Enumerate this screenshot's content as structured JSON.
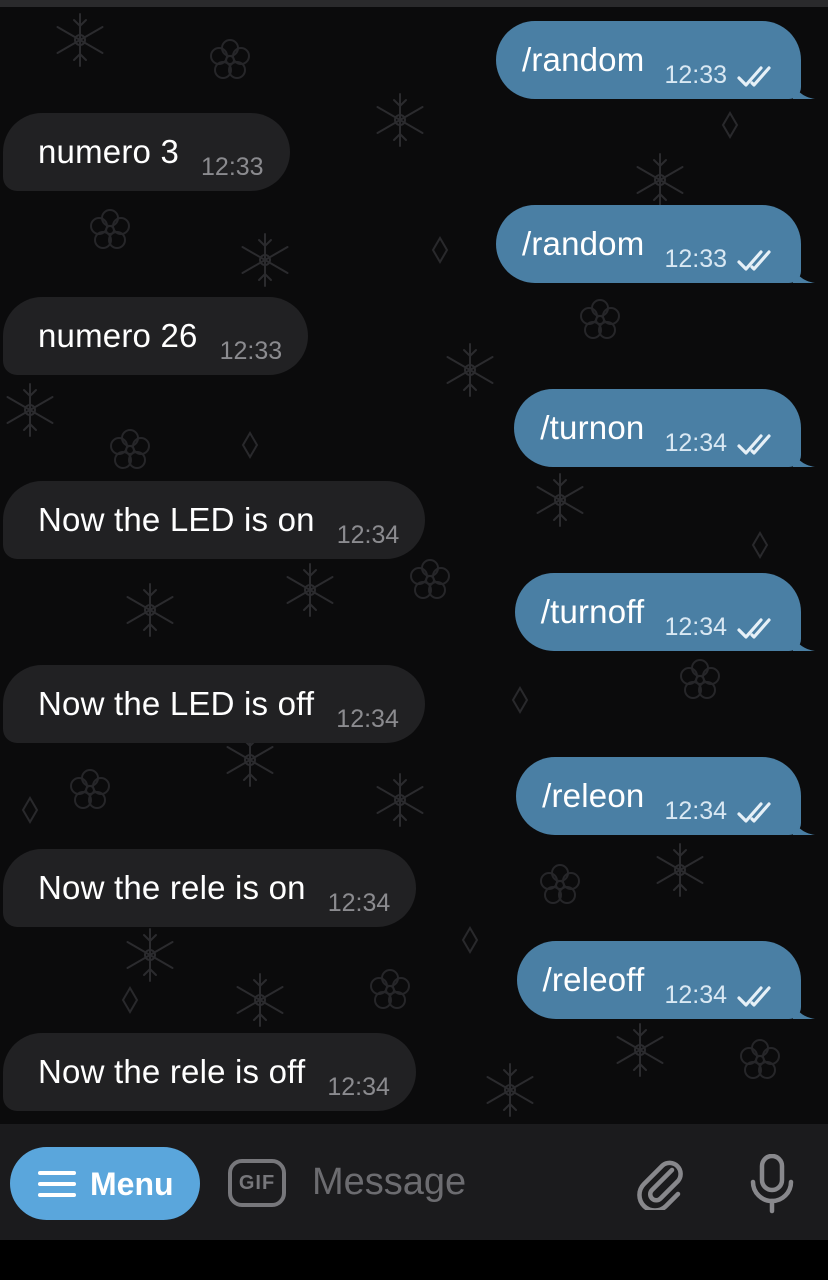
{
  "messages": [
    {
      "direction": "out",
      "text": "/random",
      "time": "12:33",
      "status": "read"
    },
    {
      "direction": "in",
      "text": "numero 3",
      "time": "12:33"
    },
    {
      "direction": "out",
      "text": "/random",
      "time": "12:33",
      "status": "read"
    },
    {
      "direction": "in",
      "text": "numero 26",
      "time": "12:33"
    },
    {
      "direction": "out",
      "text": "/turnon",
      "time": "12:34",
      "status": "read"
    },
    {
      "direction": "in",
      "text": "Now the LED is on",
      "time": "12:34"
    },
    {
      "direction": "out",
      "text": "/turnoff",
      "time": "12:34",
      "status": "read"
    },
    {
      "direction": "in",
      "text": "Now the LED is off",
      "time": "12:34"
    },
    {
      "direction": "out",
      "text": "/releon",
      "time": "12:34",
      "status": "read"
    },
    {
      "direction": "in",
      "text": "Now the rele is on",
      "time": "12:34"
    },
    {
      "direction": "out",
      "text": "/releoff",
      "time": "12:34",
      "status": "read"
    },
    {
      "direction": "in",
      "text": "Now the rele is off",
      "time": "12:34"
    }
  ],
  "input_bar": {
    "menu_label": "Menu",
    "menu_icon": "hamburger-icon",
    "gif_label": "GIF",
    "message_placeholder": "Message",
    "attach_icon": "paperclip-icon",
    "mic_icon": "microphone-icon"
  },
  "colors": {
    "background": "#0b0b0c",
    "outgoing_bubble": "#4a7fa4",
    "incoming_bubble": "#212123",
    "menu_button": "#5aa6dc"
  }
}
